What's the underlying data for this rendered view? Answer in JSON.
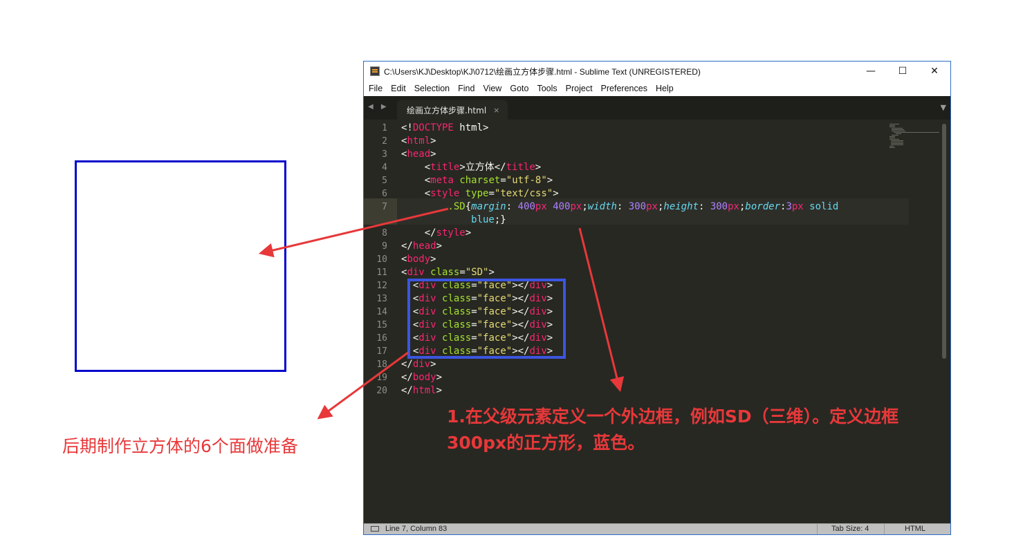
{
  "window": {
    "title": "C:\\Users\\KJ\\Desktop\\KJ\\0712\\绘画立方体步骤.html - Sublime Text (UNREGISTERED)",
    "minimize": "—",
    "maximize": "☐",
    "close": "✕"
  },
  "menu": [
    "File",
    "Edit",
    "Selection",
    "Find",
    "View",
    "Goto",
    "Tools",
    "Project",
    "Preferences",
    "Help"
  ],
  "tab": {
    "nav": "◀ ▶",
    "label": "绘画立方体步骤.html",
    "close": "×",
    "dropdown": "▼"
  },
  "line_numbers": [
    "1",
    "2",
    "3",
    "4",
    "5",
    "6",
    "7",
    "",
    "8",
    "9",
    "10",
    "11",
    "12",
    "13",
    "14",
    "15",
    "16",
    "17",
    "18",
    "19",
    "20"
  ],
  "code": {
    "l1": [
      "<!",
      "DOCTYPE",
      " html",
      ">"
    ],
    "l2": [
      "<",
      "html",
      ">"
    ],
    "l3": [
      "<",
      "head",
      ">"
    ],
    "l4": [
      "    <",
      "title",
      ">立方体</",
      "title",
      ">"
    ],
    "l5": [
      "    <",
      "meta",
      " ",
      "charset",
      "=",
      "\"utf-8\"",
      ">"
    ],
    "l6": [
      "    <",
      "style",
      " ",
      "type",
      "=",
      "\"text/css\"",
      ">"
    ],
    "l7": [
      "        .SD",
      "{",
      "margin",
      ": ",
      "400",
      "px",
      " ",
      "400",
      "px",
      ";",
      "width",
      ": ",
      "300",
      "px",
      ";",
      "height",
      ": ",
      "300",
      "px",
      ";",
      "border",
      ":",
      "3",
      "px",
      " solid"
    ],
    "l7b": [
      "            blue",
      ";}"
    ],
    "l8": [
      "    </",
      "style",
      ">"
    ],
    "l9": [
      "</",
      "head",
      ">"
    ],
    "l10": [
      "<",
      "body",
      ">"
    ],
    "l11": [
      "<",
      "div",
      " ",
      "class",
      "=",
      "\"SD\"",
      ">"
    ],
    "face": [
      "  <",
      "div",
      " ",
      "class",
      "=",
      "\"face\"",
      "></",
      "div",
      ">"
    ],
    "l18": [
      "</",
      "div",
      ">"
    ],
    "l19": [
      "</",
      "body",
      ">"
    ],
    "l20": [
      "</",
      "html",
      ">"
    ]
  },
  "status": {
    "position": "Line 7, Column 83",
    "tab_size": "Tab Size: 4",
    "syntax": "HTML"
  },
  "annotations": {
    "left": "后期制作立方体的6个面做准备",
    "right": "1.在父级元素定义一个外边框，例如SD（三维）。定义边框300px的正方形，蓝色。"
  },
  "colors": {
    "square_border": "#0000cc",
    "annotation": "#e8383a",
    "highlight_box": "#3c55e0"
  }
}
